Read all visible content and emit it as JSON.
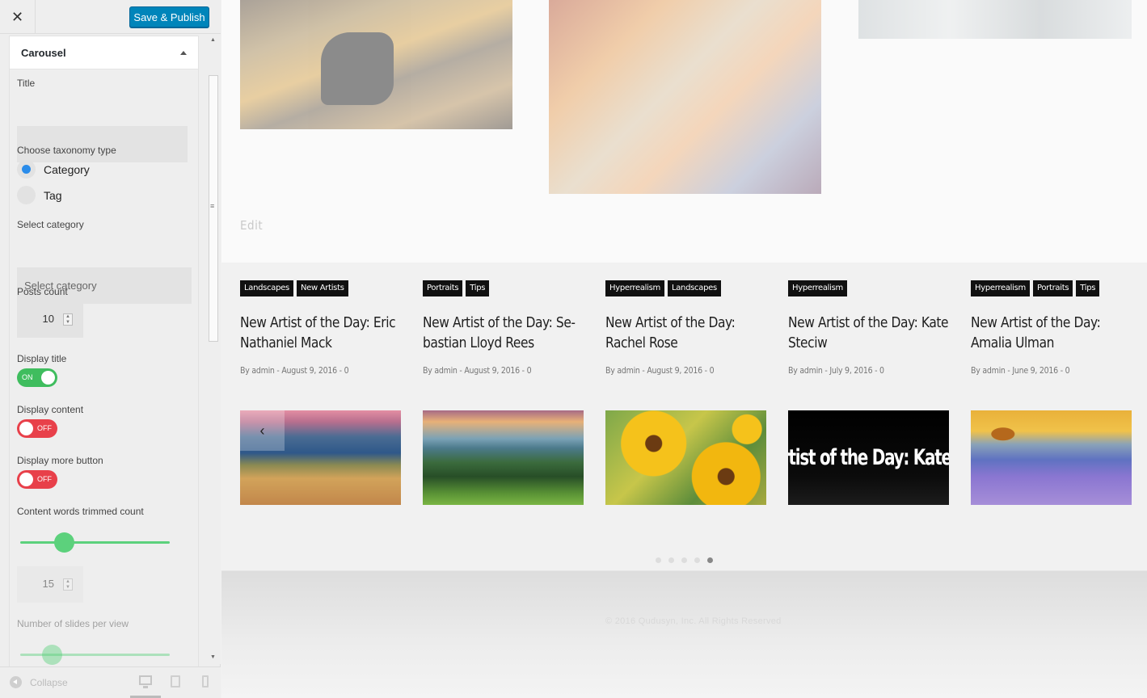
{
  "customizer": {
    "close_label": "✕",
    "publish_label": "Save & Publish",
    "section_title": "Carousel",
    "fields": {
      "title_label": "Title",
      "title_value": "",
      "taxonomy_label": "Choose taxonomy type",
      "taxonomy_options": [
        "Category",
        "Tag"
      ],
      "taxonomy_selected": "Category",
      "category_label": "Select category",
      "category_placeholder": "Select category",
      "posts_count_label": "Posts count",
      "posts_count_value": "10",
      "display_title_label": "Display title",
      "display_title_state": "ON",
      "display_content_label": "Display content",
      "display_content_state": "OFF",
      "display_more_label": "Display more button",
      "display_more_state": "OFF",
      "trim_label": "Content words trimmed count",
      "trim_value": "15",
      "trim_slider_fraction": 0.3,
      "slides_label": "Number of slides per view",
      "slides_slider_fraction": 0.2
    },
    "footer": {
      "collapse_label": "Collapse"
    }
  },
  "preview": {
    "edit_label": "Edit",
    "posts": [
      {
        "tags": [
          "Landscapes",
          "New Artists"
        ],
        "title": "New Artist of the Day: Eric Nathaniel Mack",
        "meta": "By admin - August 9, 2016 - 0",
        "image": "mountain-landscape"
      },
      {
        "tags": [
          "Portraits",
          "Tips"
        ],
        "title": "New Artist of the Day: Se-bastian Lloyd Rees",
        "meta": "By admin - August 9, 2016 - 0",
        "image": "forest-valley"
      },
      {
        "tags": [
          "Hyperrealism",
          "Landscapes"
        ],
        "title": "New Artist of the Day: Rachel Rose",
        "meta": "By admin - August 9, 2016 - 0",
        "image": "sunflowers"
      },
      {
        "tags": [
          "Hyperrealism"
        ],
        "title": "New Artist of the Day: Kate Steciw",
        "meta": "By admin - July 9, 2016 - 0",
        "image": "text-banner",
        "image_text": "Artist of the Day: Kate S"
      },
      {
        "tags": [
          "Hyperrealism",
          "Portraits",
          "Tips"
        ],
        "title": "New Artist of the Day: Amalia Ulman",
        "meta": "By admin - June 9, 2016 - 0",
        "image": "lavender-field"
      }
    ],
    "prev_arrow": "‹",
    "dots_count": 5,
    "active_dot": 5,
    "copyright": "© 2016 Qudusyn, Inc. All Rights Reserved"
  }
}
